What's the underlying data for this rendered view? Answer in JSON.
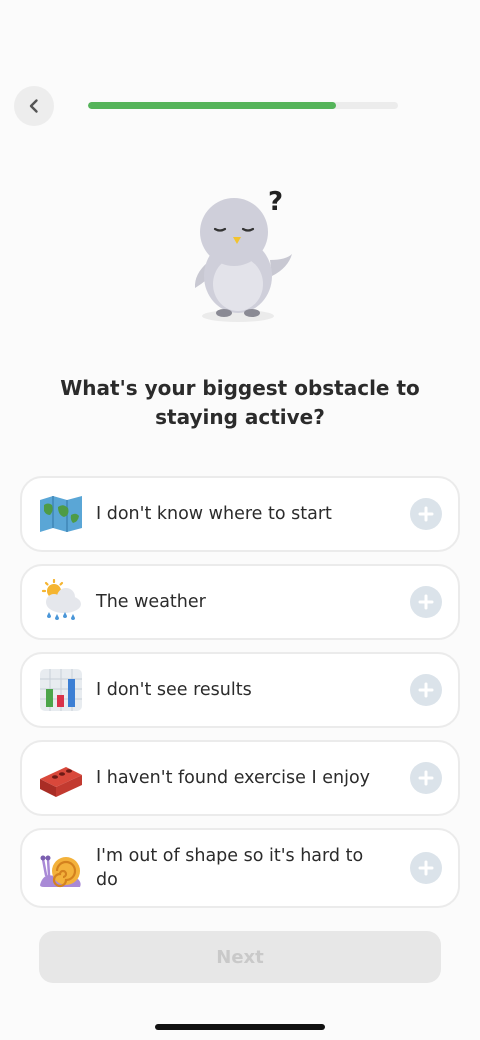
{
  "progress": {
    "fraction": 0.8
  },
  "mascot": {
    "bubble": "?"
  },
  "question": "What's your biggest obstacle to staying active?",
  "options": [
    {
      "icon": "map-icon",
      "label": "I don't know where to start"
    },
    {
      "icon": "sun-rain-cloud-icon",
      "label": "The weather"
    },
    {
      "icon": "bar-chart-icon",
      "label": "I don't see results"
    },
    {
      "icon": "brick-icon",
      "label": "I haven't found exercise I enjoy"
    },
    {
      "icon": "snail-icon",
      "label": "I'm out of shape so it's hard to do"
    }
  ],
  "next_label": "Next",
  "colors": {
    "progress": "#55b45a",
    "plus_button": "#dbe3ea",
    "next_disabled_bg": "#e7e7e7",
    "next_disabled_text": "#c9c9c9"
  }
}
